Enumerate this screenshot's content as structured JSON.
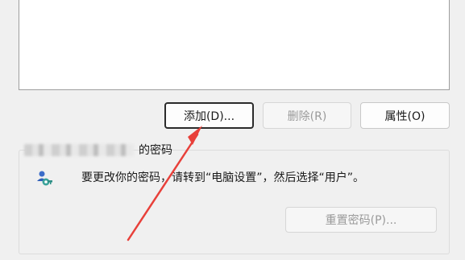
{
  "buttons": {
    "add": "添加(D)...",
    "remove": "删除(R)",
    "properties": "属性(O)"
  },
  "password_section": {
    "heading_suffix": "的密码",
    "message": "要更改你的密码，请转到“电脑设置”，然后选择“用户”。",
    "reset_button": "重置密码(P)..."
  },
  "icons": {
    "user_icon": "users-key-icon"
  },
  "annotation": {
    "arrow_color": "#e8403a"
  }
}
